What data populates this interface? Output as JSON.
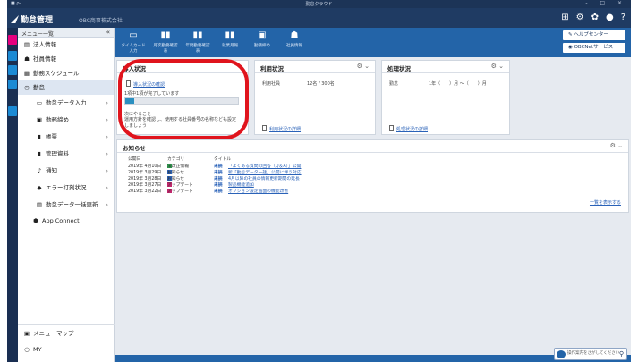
{
  "titlebar": {
    "left": "■ ρ-",
    "title": "勤怠クラウド",
    "controls": "- □ ×"
  },
  "brand": {
    "name": "勤怠管理",
    "company": "OBC商事株式会社"
  },
  "sidebar": {
    "header": "メニュー一覧",
    "collapse": "«",
    "items": [
      {
        "label": "法人情報",
        "icon": "building-icon"
      },
      {
        "label": "社員情報",
        "icon": "people-icon"
      },
      {
        "label": "勤務スケジュール",
        "icon": "calendar-icon"
      },
      {
        "label": "勤怠",
        "icon": "clock-icon"
      },
      {
        "label": "勤怠データ入力",
        "icon": "document-icon"
      },
      {
        "label": "勤務締め",
        "icon": "lock-icon"
      },
      {
        "label": "帳票",
        "icon": "bar-chart-icon"
      },
      {
        "label": "管理資料",
        "icon": "bar-chart-icon"
      },
      {
        "label": "通知",
        "icon": "bell-icon"
      },
      {
        "label": "エラー打刻状況",
        "icon": "error-icon"
      },
      {
        "label": "勤怠データ一括更新",
        "icon": "refresh-icon"
      },
      {
        "label": "App Connect",
        "icon": "connect-icon"
      }
    ],
    "bottom": [
      {
        "label": "メニューマップ",
        "icon": "map-icon"
      },
      {
        "label": "MY",
        "icon": "user-icon"
      }
    ]
  },
  "toolbar": {
    "tools": [
      {
        "label": "タイムカード入力",
        "icon": "card-icon"
      },
      {
        "label": "月次勤務確認表",
        "icon": "bar-chart-icon"
      },
      {
        "label": "年間勤務確認表",
        "icon": "bar-chart-icon"
      },
      {
        "label": "就業月報",
        "icon": "bar-chart-icon"
      },
      {
        "label": "勤務締め",
        "icon": "lock-icon"
      },
      {
        "label": "社員情報",
        "icon": "people-icon"
      }
    ],
    "help_center": "ヘルプセンター",
    "obc_service": "OBCNetサービス"
  },
  "panels": {
    "intro": {
      "title": "導入状況",
      "link": "導入状況の確認",
      "progress_text": "1項中1項が完了しています",
      "progress_value": 0.08,
      "todo_heading": "次にやること",
      "todo_text": "運用方針を確認し、使用する社員番号の名称なども設定しましょう"
    },
    "usage": {
      "title": "利用状況",
      "label": "利用社員",
      "value": "12名 / 300名",
      "link": "利用状況の詳細",
      "opt": "⚙ ⌄"
    },
    "process": {
      "title": "処理状況",
      "label": "勤怠",
      "value": "1年（　　）月 ～（　　）月",
      "link": "処理状況の詳細",
      "opt": "⚙ ⌄"
    },
    "notices": {
      "title": "お知らせ",
      "opt": "⚙ ⌄",
      "columns": [
        "公開日",
        "カテゴリ",
        "タイトル"
      ],
      "rows": [
        {
          "date": "2019年 4月10日",
          "category": "法改正情報",
          "cat_color": "#2e9e4f",
          "mark": "未読",
          "title": "「よくある質問の回答（Q＆A）」公開"
        },
        {
          "date": "2019年 3月29日",
          "category": "お知らせ",
          "cat_color": "#2a62b8",
          "mark": "未読",
          "title": "新「勤怠データ一括」公開に伴う対応"
        },
        {
          "date": "2019年 3月28日",
          "category": "お知らせ",
          "cat_color": "#2a62b8",
          "mark": "未読",
          "title": "4月以降の社員の情報更新期間の延長"
        },
        {
          "date": "2019年 3月27日",
          "category": "アップデート",
          "cat_color": "#c0266b",
          "mark": "未読",
          "title": "製品機能追加"
        },
        {
          "date": "2019年 3月22日",
          "category": "アップデート",
          "cat_color": "#c0266b",
          "mark": "未読",
          "title": "オプション設定画面の機能改善"
        }
      ],
      "more_link": "一覧を表示する"
    }
  },
  "widget": {
    "label": "操作案内をさがしてください"
  },
  "colors": {
    "brand_dark": "#1f3b63",
    "toolbar_blue": "#2364a8",
    "highlight_red": "#e0141d"
  }
}
